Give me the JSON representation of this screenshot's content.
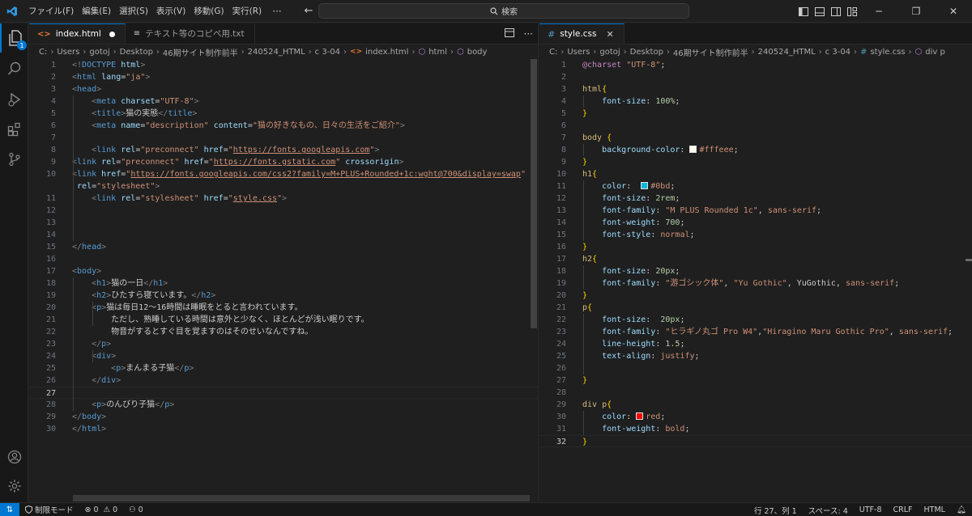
{
  "menu": [
    "ファイル(F)",
    "編集(E)",
    "選択(S)",
    "表示(V)",
    "移動(G)",
    "実行(R)"
  ],
  "menu_more": "···",
  "search": {
    "label": "検索"
  },
  "colors": {
    "accent": "#0078d4",
    "background": "#1f1f1f"
  },
  "left_tabs": [
    {
      "label": "index.html",
      "icon": "html-file-icon",
      "dirty": true
    },
    {
      "label": "テキスト等のコピペ用.txt",
      "icon": "text-file-icon"
    }
  ],
  "right_tabs": [
    {
      "label": "style.css",
      "icon": "css-file-icon"
    }
  ],
  "left_breadcrumb": [
    "C:",
    "Users",
    "gotoj",
    "Desktop",
    "46期サイト制作前半",
    "240524_HTML",
    "c 3-04",
    "index.html",
    "html",
    "body"
  ],
  "right_breadcrumb": [
    "C:",
    "Users",
    "gotoj",
    "Desktop",
    "46期サイト制作前半",
    "240524_HTML",
    "c 3-04",
    "style.css",
    "div p"
  ],
  "html_lines": [
    {
      "n": "1",
      "s": [
        [
          "br",
          "<!"
        ],
        [
          "tag",
          "DOCTYPE"
        ],
        [
          "plain",
          " "
        ],
        [
          "attr",
          "html"
        ],
        [
          "br",
          ">"
        ]
      ]
    },
    {
      "n": "2",
      "s": [
        [
          "br",
          "<"
        ],
        [
          "tag",
          "html"
        ],
        [
          "plain",
          " "
        ],
        [
          "attr",
          "lang"
        ],
        [
          "plain",
          "="
        ],
        [
          "str",
          "\"ja\""
        ],
        [
          "br",
          ">"
        ]
      ]
    },
    {
      "n": "3",
      "s": [
        [
          "br",
          "<"
        ],
        [
          "tag",
          "head"
        ],
        [
          "br",
          ">"
        ]
      ]
    },
    {
      "n": "4",
      "s": [
        [
          "plain",
          "    "
        ],
        [
          "br",
          "<"
        ],
        [
          "tag",
          "meta"
        ],
        [
          "plain",
          " "
        ],
        [
          "attr",
          "charset"
        ],
        [
          "plain",
          "="
        ],
        [
          "str",
          "\"UTF-8\""
        ],
        [
          "br",
          ">"
        ]
      ]
    },
    {
      "n": "5",
      "s": [
        [
          "plain",
          "    "
        ],
        [
          "br",
          "<"
        ],
        [
          "tag",
          "title"
        ],
        [
          "br",
          ">"
        ],
        [
          "txt",
          "猫の実態"
        ],
        [
          "br",
          "</"
        ],
        [
          "tag",
          "title"
        ],
        [
          "br",
          ">"
        ]
      ]
    },
    {
      "n": "6",
      "s": [
        [
          "plain",
          "    "
        ],
        [
          "br",
          "<"
        ],
        [
          "tag",
          "meta"
        ],
        [
          "plain",
          " "
        ],
        [
          "attr",
          "name"
        ],
        [
          "plain",
          "="
        ],
        [
          "str",
          "\"description\""
        ],
        [
          "plain",
          " "
        ],
        [
          "attr",
          "content"
        ],
        [
          "plain",
          "="
        ],
        [
          "str",
          "\"猫の好きなもの、日々の生活をご紹介\""
        ],
        [
          "br",
          ">"
        ]
      ]
    },
    {
      "n": "7",
      "s": []
    },
    {
      "n": "8",
      "s": [
        [
          "plain",
          "    "
        ],
        [
          "br",
          "<"
        ],
        [
          "tag",
          "link"
        ],
        [
          "plain",
          " "
        ],
        [
          "attr",
          "rel"
        ],
        [
          "plain",
          "="
        ],
        [
          "str",
          "\"preconnect\""
        ],
        [
          "plain",
          " "
        ],
        [
          "attr",
          "href"
        ],
        [
          "plain",
          "="
        ],
        [
          "str",
          "\""
        ],
        [
          "url",
          "https://fonts.googleapis.com"
        ],
        [
          "str",
          "\""
        ],
        [
          "br",
          ">"
        ]
      ]
    },
    {
      "n": "9",
      "s": [
        [
          "br",
          "<"
        ],
        [
          "tag",
          "link"
        ],
        [
          "plain",
          " "
        ],
        [
          "attr",
          "rel"
        ],
        [
          "plain",
          "="
        ],
        [
          "str",
          "\"preconnect\""
        ],
        [
          "plain",
          " "
        ],
        [
          "attr",
          "href"
        ],
        [
          "plain",
          "="
        ],
        [
          "str",
          "\""
        ],
        [
          "url",
          "https://fonts.gstatic.com"
        ],
        [
          "str",
          "\""
        ],
        [
          "plain",
          " "
        ],
        [
          "attr",
          "crossorigin"
        ],
        [
          "br",
          ">"
        ]
      ]
    },
    {
      "n": "10",
      "s": [
        [
          "br",
          "<"
        ],
        [
          "tag",
          "link"
        ],
        [
          "plain",
          " "
        ],
        [
          "attr",
          "href"
        ],
        [
          "plain",
          "="
        ],
        [
          "str",
          "\""
        ],
        [
          "url",
          "https://fonts.googleapis.com/css2?family=M+PLUS+Rounded+1c:wght@700&display=swap"
        ],
        [
          "str",
          "\""
        ]
      ]
    },
    {
      "n": "",
      "s": [
        [
          "plain",
          " "
        ],
        [
          "attr",
          "rel"
        ],
        [
          "plain",
          "="
        ],
        [
          "str",
          "\"stylesheet\""
        ],
        [
          "br",
          ">"
        ]
      ]
    },
    {
      "n": "11",
      "s": [
        [
          "plain",
          "    "
        ],
        [
          "br",
          "<"
        ],
        [
          "tag",
          "link"
        ],
        [
          "plain",
          " "
        ],
        [
          "attr",
          "rel"
        ],
        [
          "plain",
          "="
        ],
        [
          "str",
          "\"stylesheet\""
        ],
        [
          "plain",
          " "
        ],
        [
          "attr",
          "href"
        ],
        [
          "plain",
          "="
        ],
        [
          "str",
          "\""
        ],
        [
          "url",
          "style.css"
        ],
        [
          "str",
          "\""
        ],
        [
          "br",
          ">"
        ]
      ]
    },
    {
      "n": "12",
      "s": []
    },
    {
      "n": "13",
      "s": []
    },
    {
      "n": "14",
      "s": []
    },
    {
      "n": "15",
      "s": [
        [
          "br",
          "</"
        ],
        [
          "tag",
          "head"
        ],
        [
          "br",
          ">"
        ]
      ]
    },
    {
      "n": "16",
      "s": []
    },
    {
      "n": "17",
      "s": [
        [
          "br",
          "<"
        ],
        [
          "tag",
          "body"
        ],
        [
          "br",
          ">"
        ]
      ]
    },
    {
      "n": "18",
      "s": [
        [
          "plain",
          "    "
        ],
        [
          "br",
          "<"
        ],
        [
          "tag",
          "h1"
        ],
        [
          "br",
          ">"
        ],
        [
          "txt",
          "猫の一日"
        ],
        [
          "br",
          "</"
        ],
        [
          "tag",
          "h1"
        ],
        [
          "br",
          ">"
        ]
      ]
    },
    {
      "n": "19",
      "s": [
        [
          "plain",
          "    "
        ],
        [
          "br",
          "<"
        ],
        [
          "tag",
          "h2"
        ],
        [
          "br",
          ">"
        ],
        [
          "txt",
          "ひたすら寝ています。"
        ],
        [
          "br",
          "</"
        ],
        [
          "tag",
          "h2"
        ],
        [
          "br",
          ">"
        ]
      ]
    },
    {
      "n": "20",
      "s": [
        [
          "plain",
          "    "
        ],
        [
          "br",
          "<"
        ],
        [
          "tag",
          "p"
        ],
        [
          "br",
          ">"
        ],
        [
          "txt",
          "猫は毎日12〜16時間は睡眠をとると言われています。"
        ]
      ]
    },
    {
      "n": "21",
      "s": [
        [
          "txt",
          "        ただし、熟睡している時間は意外と少なく、ほとんどが浅い眠りです。"
        ]
      ]
    },
    {
      "n": "22",
      "s": [
        [
          "txt",
          "        物音がするとすぐ目を覚ますのはそのせいなんですね。"
        ]
      ]
    },
    {
      "n": "23",
      "s": [
        [
          "plain",
          "    "
        ],
        [
          "br",
          "</"
        ],
        [
          "tag",
          "p"
        ],
        [
          "br",
          ">"
        ]
      ]
    },
    {
      "n": "24",
      "s": [
        [
          "plain",
          "    "
        ],
        [
          "br",
          "<"
        ],
        [
          "tag",
          "div"
        ],
        [
          "br",
          ">"
        ]
      ]
    },
    {
      "n": "25",
      "s": [
        [
          "plain",
          "        "
        ],
        [
          "br",
          "<"
        ],
        [
          "tag",
          "p"
        ],
        [
          "br",
          ">"
        ],
        [
          "txt",
          "まんまる子猫"
        ],
        [
          "br",
          "</"
        ],
        [
          "tag",
          "p"
        ],
        [
          "br",
          ">"
        ]
      ]
    },
    {
      "n": "26",
      "s": [
        [
          "plain",
          "    "
        ],
        [
          "br",
          "</"
        ],
        [
          "tag",
          "div"
        ],
        [
          "br",
          ">"
        ]
      ]
    },
    {
      "n": "27",
      "s": []
    },
    {
      "n": "28",
      "s": [
        [
          "plain",
          "    "
        ],
        [
          "br",
          "<"
        ],
        [
          "tag",
          "p"
        ],
        [
          "br",
          ">"
        ],
        [
          "txt",
          "のんびり子猫"
        ],
        [
          "br",
          "</"
        ],
        [
          "tag",
          "p"
        ],
        [
          "br",
          ">"
        ]
      ]
    },
    {
      "n": "29",
      "s": [
        [
          "br",
          "</"
        ],
        [
          "tag",
          "body"
        ],
        [
          "br",
          ">"
        ]
      ]
    },
    {
      "n": "30",
      "s": [
        [
          "br",
          "</"
        ],
        [
          "tag",
          "html"
        ],
        [
          "br",
          ">"
        ]
      ]
    }
  ],
  "css_lines": [
    {
      "n": "1",
      "s": [
        [
          "kw",
          "@charset"
        ],
        [
          "plain",
          " "
        ],
        [
          "val",
          "\"UTF-8\""
        ],
        [
          "plain",
          ";"
        ]
      ]
    },
    {
      "n": "2",
      "s": []
    },
    {
      "n": "3",
      "s": [
        [
          "sel",
          "html"
        ],
        [
          "brace",
          "{"
        ]
      ]
    },
    {
      "n": "4",
      "s": [
        [
          "plain",
          "    "
        ],
        [
          "prop",
          "font-size"
        ],
        [
          "plain",
          ": "
        ],
        [
          "num",
          "100%"
        ],
        [
          "plain",
          ";"
        ]
      ]
    },
    {
      "n": "5",
      "s": [
        [
          "brace",
          "}"
        ]
      ]
    },
    {
      "n": "6",
      "s": []
    },
    {
      "n": "7",
      "s": [
        [
          "sel",
          "body"
        ],
        [
          "plain",
          " "
        ],
        [
          "brace",
          "{"
        ]
      ]
    },
    {
      "n": "8",
      "s": [
        [
          "plain",
          "    "
        ],
        [
          "prop",
          "background-color"
        ],
        [
          "plain",
          ": "
        ],
        [
          "swatch",
          "#fffeee"
        ],
        [
          "val",
          "#fffeee"
        ],
        [
          "plain",
          ";"
        ]
      ]
    },
    {
      "n": "9",
      "s": [
        [
          "brace",
          "}"
        ]
      ]
    },
    {
      "n": "10",
      "s": [
        [
          "sel",
          "h1"
        ],
        [
          "brace",
          "{"
        ]
      ]
    },
    {
      "n": "11",
      "s": [
        [
          "plain",
          "    "
        ],
        [
          "prop",
          "color"
        ],
        [
          "plain",
          ":  "
        ],
        [
          "swatch",
          "#0bd"
        ],
        [
          "val",
          "#0bd"
        ],
        [
          "plain",
          ";"
        ]
      ]
    },
    {
      "n": "12",
      "s": [
        [
          "plain",
          "    "
        ],
        [
          "prop",
          "font-size"
        ],
        [
          "plain",
          ": "
        ],
        [
          "num",
          "2rem"
        ],
        [
          "plain",
          ";"
        ]
      ]
    },
    {
      "n": "13",
      "s": [
        [
          "plain",
          "    "
        ],
        [
          "prop",
          "font-family"
        ],
        [
          "plain",
          ": "
        ],
        [
          "val",
          "\"M PLUS Rounded 1c\""
        ],
        [
          "plain",
          ", "
        ],
        [
          "val",
          "sans-serif"
        ],
        [
          "plain",
          ";"
        ]
      ]
    },
    {
      "n": "14",
      "s": [
        [
          "plain",
          "    "
        ],
        [
          "prop",
          "font-weight"
        ],
        [
          "plain",
          ": "
        ],
        [
          "num",
          "700"
        ],
        [
          "plain",
          ";"
        ]
      ]
    },
    {
      "n": "15",
      "s": [
        [
          "plain",
          "    "
        ],
        [
          "prop",
          "font-style"
        ],
        [
          "plain",
          ": "
        ],
        [
          "val",
          "normal"
        ],
        [
          "plain",
          ";"
        ]
      ]
    },
    {
      "n": "16",
      "s": [
        [
          "brace",
          "}"
        ]
      ]
    },
    {
      "n": "17",
      "s": [
        [
          "sel",
          "h2"
        ],
        [
          "brace",
          "{"
        ]
      ]
    },
    {
      "n": "18",
      "s": [
        [
          "plain",
          "    "
        ],
        [
          "prop",
          "font-size"
        ],
        [
          "plain",
          ": "
        ],
        [
          "num",
          "20px"
        ],
        [
          "plain",
          ";"
        ]
      ]
    },
    {
      "n": "19",
      "s": [
        [
          "plain",
          "    "
        ],
        [
          "prop",
          "font-family"
        ],
        [
          "plain",
          ": "
        ],
        [
          "val",
          "\"游ゴシック体\""
        ],
        [
          "plain",
          ", "
        ],
        [
          "val",
          "\"Yu Gothic\""
        ],
        [
          "plain",
          ", "
        ],
        [
          "plain",
          "YuGothic"
        ],
        [
          "plain",
          ", "
        ],
        [
          "val",
          "sans-serif"
        ],
        [
          "plain",
          ";"
        ]
      ]
    },
    {
      "n": "20",
      "s": [
        [
          "brace",
          "}"
        ]
      ]
    },
    {
      "n": "21",
      "s": [
        [
          "sel",
          "p"
        ],
        [
          "brace",
          "{"
        ]
      ]
    },
    {
      "n": "22",
      "s": [
        [
          "plain",
          "    "
        ],
        [
          "prop",
          "font-size"
        ],
        [
          "plain",
          ":  "
        ],
        [
          "num",
          "20px"
        ],
        [
          "plain",
          ";"
        ]
      ]
    },
    {
      "n": "23",
      "s": [
        [
          "plain",
          "    "
        ],
        [
          "prop",
          "font-family"
        ],
        [
          "plain",
          ": "
        ],
        [
          "val",
          "\"ヒラギノ丸ゴ Pro W4\""
        ],
        [
          "plain",
          ","
        ],
        [
          "val",
          "\"Hiragino Maru Gothic Pro\""
        ],
        [
          "plain",
          ", "
        ],
        [
          "val",
          "sans-serif"
        ],
        [
          "plain",
          ";"
        ]
      ]
    },
    {
      "n": "24",
      "s": [
        [
          "plain",
          "    "
        ],
        [
          "prop",
          "line-height"
        ],
        [
          "plain",
          ": "
        ],
        [
          "num",
          "1.5"
        ],
        [
          "plain",
          ";"
        ]
      ]
    },
    {
      "n": "25",
      "s": [
        [
          "plain",
          "    "
        ],
        [
          "prop",
          "text-align"
        ],
        [
          "plain",
          ": "
        ],
        [
          "val",
          "justify"
        ],
        [
          "plain",
          ";"
        ]
      ]
    },
    {
      "n": "26",
      "s": []
    },
    {
      "n": "27",
      "s": [
        [
          "brace",
          "}"
        ]
      ]
    },
    {
      "n": "28",
      "s": []
    },
    {
      "n": "29",
      "s": [
        [
          "sel",
          "div p"
        ],
        [
          "brace",
          "{"
        ]
      ]
    },
    {
      "n": "30",
      "s": [
        [
          "plain",
          "    "
        ],
        [
          "prop",
          "color"
        ],
        [
          "plain",
          ": "
        ],
        [
          "swatch",
          "#ff0000"
        ],
        [
          "val",
          "red"
        ],
        [
          "plain",
          ";"
        ]
      ]
    },
    {
      "n": "31",
      "s": [
        [
          "plain",
          "    "
        ],
        [
          "prop",
          "font-weight"
        ],
        [
          "plain",
          ": "
        ],
        [
          "val",
          "bold"
        ],
        [
          "plain",
          ";"
        ]
      ]
    },
    {
      "n": "32",
      "s": [
        [
          "brace",
          "}"
        ]
      ]
    }
  ],
  "status": {
    "restricted_mode": "制限モード",
    "errors": "0",
    "warnings": "0",
    "ports": "0",
    "cursor": "行 27、列 1",
    "spaces": "スペース: 4",
    "encoding": "UTF-8",
    "eol": "CRLF",
    "language": "HTML"
  }
}
